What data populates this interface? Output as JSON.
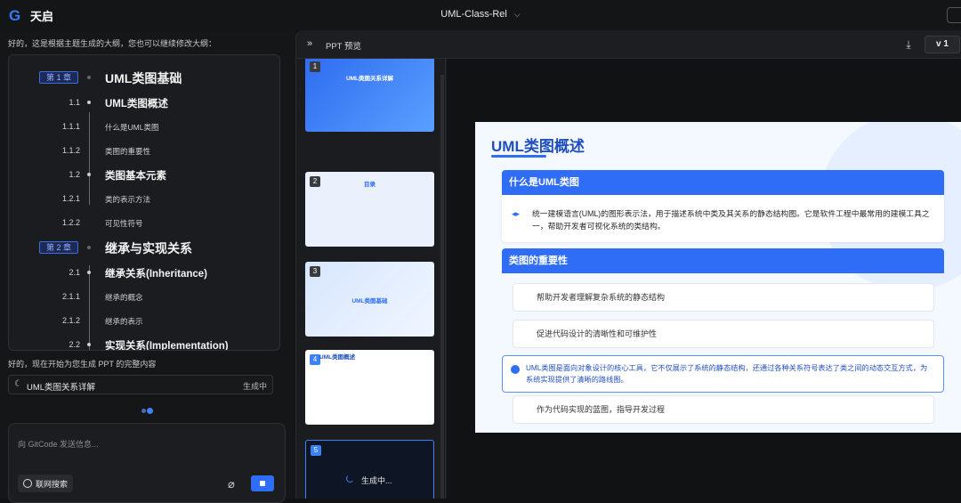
{
  "app": {
    "name": "天启",
    "logo_glyph": "G"
  },
  "window": {
    "title": "UML-Class-Rel",
    "title_chevron": "⌵"
  },
  "chat": {
    "intro": "好的，这是根据主题生成的大纲，您也可以继续修改大纲：",
    "outline": [
      {
        "kind": "chapter",
        "num": "第 1 章",
        "text": "UML类图基础"
      },
      {
        "kind": "section",
        "num": "1.1",
        "text": "UML类图概述"
      },
      {
        "kind": "sub",
        "num": "1.1.1",
        "text": "什么是UML类图"
      },
      {
        "kind": "sub",
        "num": "1.1.2",
        "text": "类图的重要性"
      },
      {
        "kind": "section",
        "num": "1.2",
        "text": "类图基本元素"
      },
      {
        "kind": "sub",
        "num": "1.2.1",
        "text": "类的表示方法"
      },
      {
        "kind": "sub",
        "num": "1.2.2",
        "text": "可见性符号"
      },
      {
        "kind": "chapter",
        "num": "第 2 章",
        "text": "继承与实现关系"
      },
      {
        "kind": "section",
        "num": "2.1",
        "text": "继承关系(Inheritance)"
      },
      {
        "kind": "sub",
        "num": "2.1.1",
        "text": "继承的概念"
      },
      {
        "kind": "sub",
        "num": "2.1.2",
        "text": "继承的表示"
      },
      {
        "kind": "section",
        "num": "2.2",
        "text": "实现关系(Implementation)"
      }
    ],
    "note": "好的，现在开始为您生成 PPT 的完整内容",
    "generation": {
      "title": "UML类图关系详解",
      "status": "生成中"
    },
    "composer": {
      "placeholder": "向 GitCode 发送信息...",
      "web_search_label": "联网搜索"
    }
  },
  "preview": {
    "panel_title": "PPT 预览",
    "version": "v 1",
    "thumbnails": [
      {
        "num": "1",
        "caption": "UML类图关系详解"
      },
      {
        "num": "2",
        "caption": "目录"
      },
      {
        "num": "3",
        "caption": "UML类图基础"
      },
      {
        "num": "4",
        "caption": "UML类图概述"
      },
      {
        "num": "5",
        "caption": "生成中..."
      }
    ],
    "slide": {
      "title": "UML类图概述",
      "card1": {
        "heading": "什么是UML类图",
        "body": "统一建模语言(UML)的图形表示法，用于描述系统中类及其关系的静态结构图。它是软件工程中最常用的建模工具之一，帮助开发者可视化系统的类结构。"
      },
      "card2": {
        "heading": "类图的重要性",
        "items": [
          "帮助开发者理解复杂系统的静态结构",
          "促进代码设计的清晰性和可维护性",
          "UML类图是面向对象设计的核心工具，它不仅展示了系统的静态结构，还通过各种关系符号表达了类之间的动态交互方式，为系统实现提供了清晰的路线图。",
          "作为代码实现的蓝图，指导开发过程"
        ]
      }
    }
  },
  "colors": {
    "accent": "#2f6df6",
    "background": "#111214"
  }
}
